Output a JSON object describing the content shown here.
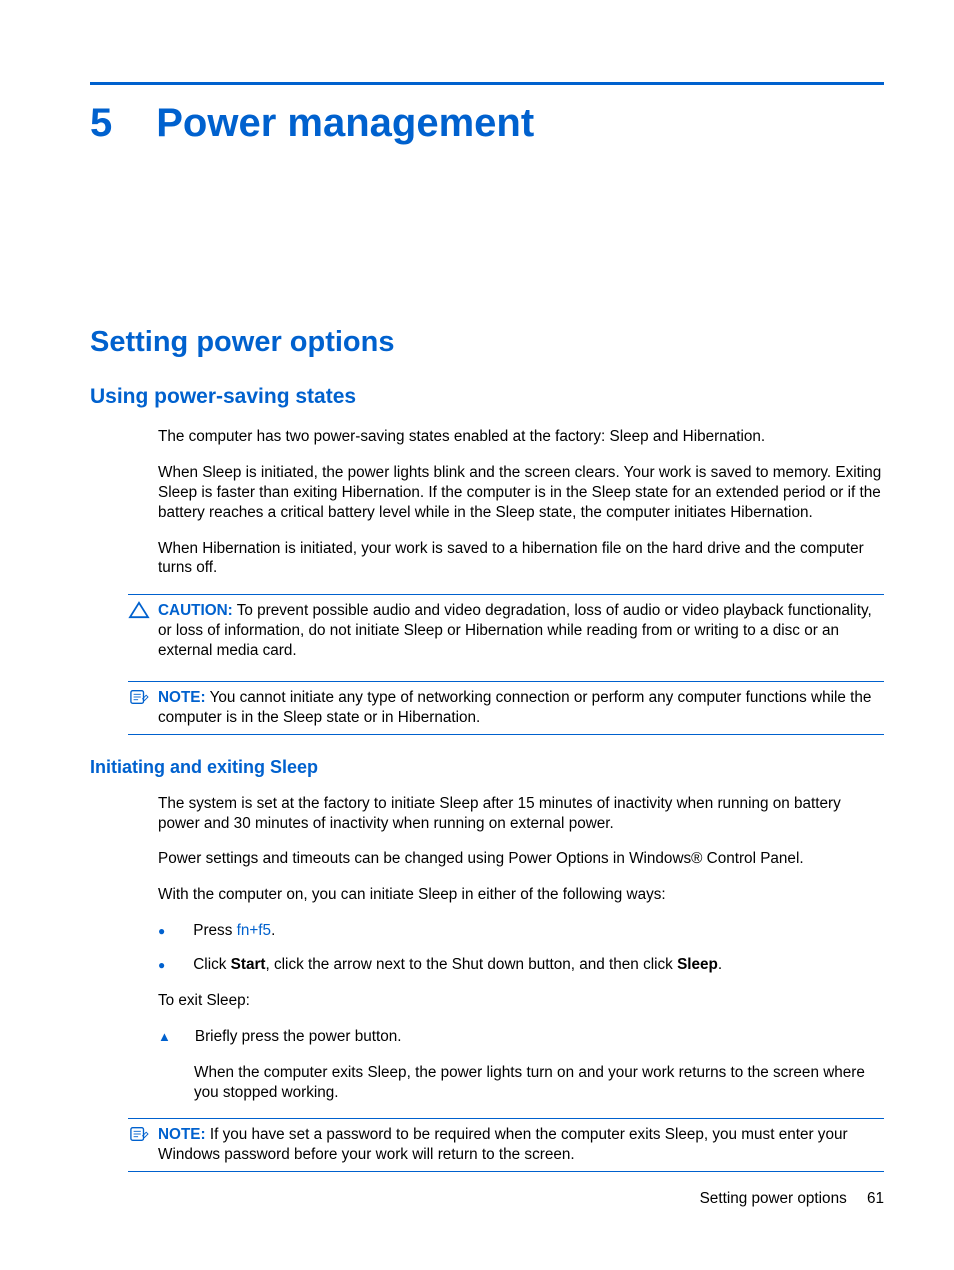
{
  "chapter": {
    "number": "5",
    "title": "Power management"
  },
  "section": {
    "title": "Setting power options"
  },
  "subsection1": {
    "title": "Using power-saving states",
    "para1": "The computer has two power-saving states enabled at the factory: Sleep and Hibernation.",
    "para2": "When Sleep is initiated, the power lights blink and the screen clears. Your work is saved to memory. Exiting Sleep is faster than exiting Hibernation. If the computer is in the Sleep state for an extended period or if the battery reaches a critical battery level while in the Sleep state, the computer initiates Hibernation.",
    "para3": "When Hibernation is initiated, your work is saved to a hibernation file on the hard drive and the computer turns off.",
    "caution_label": "CAUTION:",
    "caution_text": "To prevent possible audio and video degradation, loss of audio or video playback functionality, or loss of information, do not initiate Sleep or Hibernation while reading from or writing to a disc or an external media card.",
    "note_label": "NOTE:",
    "note_text": "You cannot initiate any type of networking connection or perform any computer functions while the computer is in the Sleep state or in Hibernation."
  },
  "subsection2": {
    "title": "Initiating and exiting Sleep",
    "para1": "The system is set at the factory to initiate Sleep after 15 minutes of inactivity when running on battery power and 30 minutes of inactivity when running on external power.",
    "para2": "Power settings and timeouts can be changed using Power Options in Windows® Control Panel.",
    "para3": "With the computer on, you can initiate Sleep in either of the following ways:",
    "bullet1_pre": "Press ",
    "bullet1_link": "fn+f5",
    "bullet1_post": ".",
    "bullet2_pre": "Click ",
    "bullet2_bold1": "Start",
    "bullet2_mid": ", click the arrow next to the Shut down button, and then click ",
    "bullet2_bold2": "Sleep",
    "bullet2_post": ".",
    "para4": "To exit Sleep:",
    "tri1": "Briefly press the power button.",
    "tri1_sub": "When the computer exits Sleep, the power lights turn on and your work returns to the screen where you stopped working.",
    "note2_label": "NOTE:",
    "note2_text": "If you have set a password to be required when the computer exits Sleep, you must enter your Windows password before your work will return to the screen."
  },
  "footer": {
    "text": "Setting power options",
    "page": "61"
  }
}
